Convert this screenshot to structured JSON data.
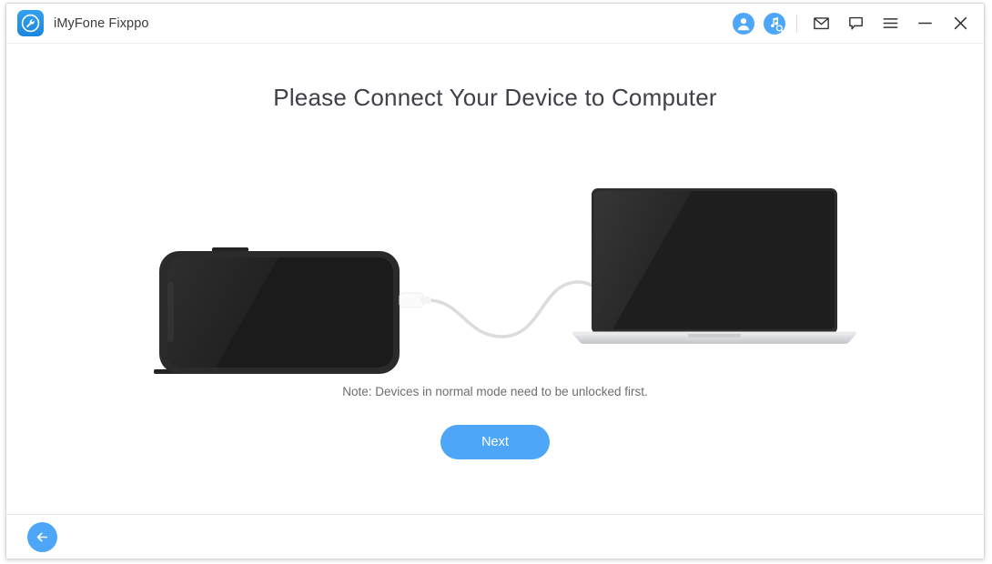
{
  "window": {
    "app_title": "iMyFone Fixppo",
    "logo_icon": "wrench-logo-icon",
    "accent_color": "#4da6f7",
    "title_color": "#3f4049"
  },
  "titlebar": {
    "icons": [
      {
        "name": "account-icon",
        "label": "Account"
      },
      {
        "name": "music-search-icon",
        "label": "Music Search"
      },
      {
        "name": "mail-icon",
        "label": "Mail"
      },
      {
        "name": "feedback-icon",
        "label": "Feedback"
      },
      {
        "name": "menu-icon",
        "label": "Menu"
      },
      {
        "name": "minimize-icon",
        "label": "Minimize"
      },
      {
        "name": "close-icon",
        "label": "Close"
      }
    ]
  },
  "main": {
    "heading": "Please Connect Your Device to Computer",
    "note": "Note: Devices in normal mode need to be unlocked first.",
    "next_label": "Next",
    "illustration": {
      "phone_icon": "smartphone-icon",
      "cable_icon": "usb-cable-icon",
      "laptop_icon": "laptop-icon",
      "phone_body_color": "#2b2b2b",
      "phone_screen_color": "#1b1b1b",
      "laptop_screen_color": "#1e1e1e",
      "laptop_base_color": "#d9dadc",
      "cable_color": "#dcdcdc"
    }
  },
  "footer": {
    "back_icon": "back-arrow-icon",
    "back_label": "Back"
  }
}
